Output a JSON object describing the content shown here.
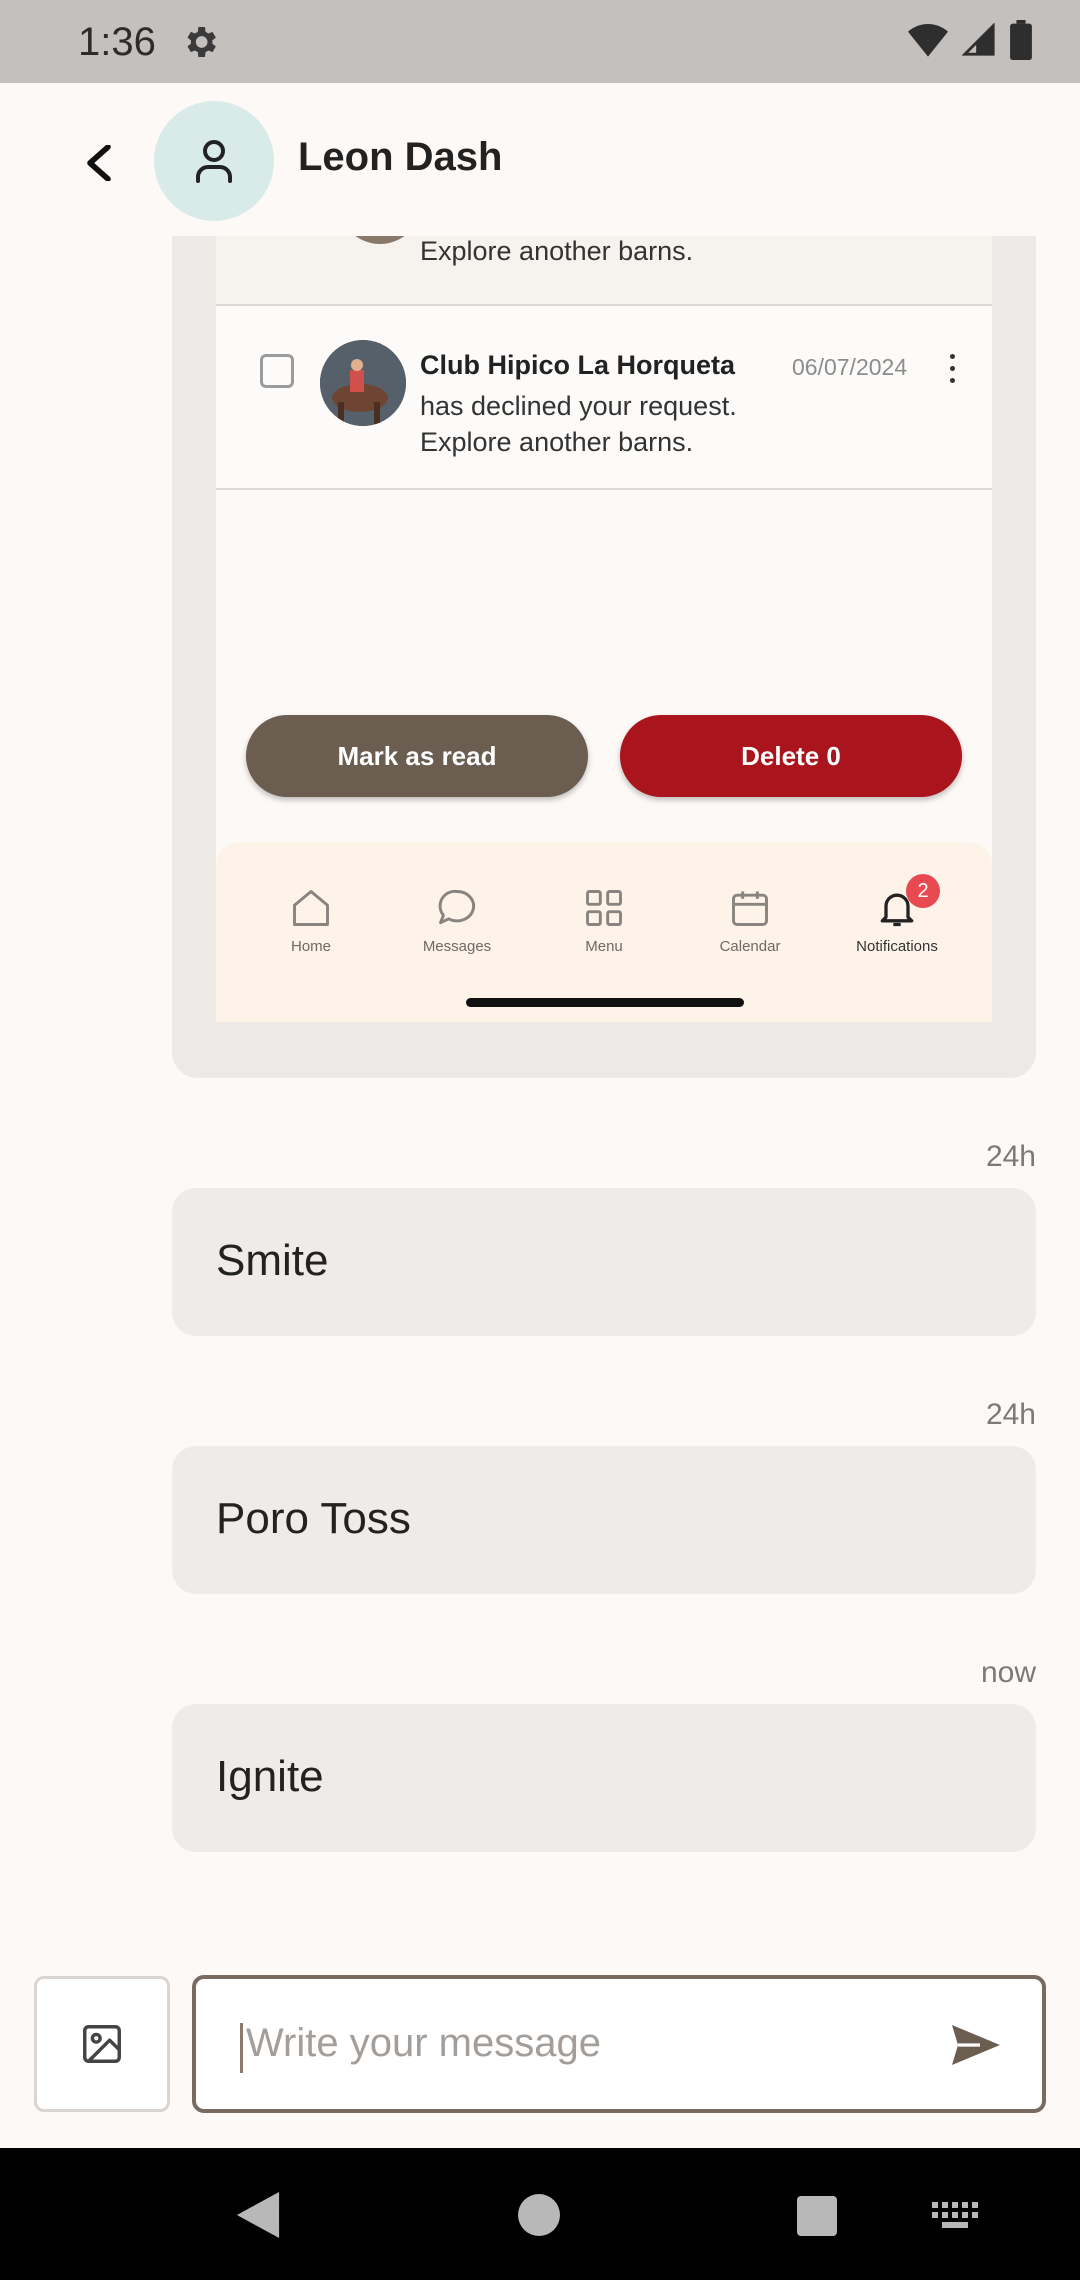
{
  "status_bar": {
    "time": "1:36"
  },
  "header": {
    "contact_name": "Leon Dash"
  },
  "shared_screenshot": {
    "top_notification": {
      "text": "Explore another barns."
    },
    "notification": {
      "title": "Club Hipico La Horqueta",
      "body": "has declined your request. Explore another barns.",
      "date": "06/07/2024"
    },
    "buttons": {
      "mark_as_read": "Mark as read",
      "delete": "Delete 0"
    },
    "bottom_nav": {
      "items": [
        {
          "label": "Home",
          "icon": "home-icon"
        },
        {
          "label": "Messages",
          "icon": "chat-bubble-icon"
        },
        {
          "label": "Menu",
          "icon": "grid-icon"
        },
        {
          "label": "Calendar",
          "icon": "calendar-icon"
        },
        {
          "label": "Notifications",
          "icon": "bell-icon"
        }
      ],
      "notification_badge": "2"
    }
  },
  "messages": [
    {
      "time": "24h",
      "text": "Smite"
    },
    {
      "time": "24h",
      "text": "Poro Toss"
    },
    {
      "time": "now",
      "text": "Ignite"
    }
  ],
  "composer": {
    "placeholder": "Write your message"
  },
  "colors": {
    "accent": "#6b5d50",
    "danger": "#a9141d",
    "background": "#fdf9f6",
    "bubble": "#eeebe9"
  }
}
